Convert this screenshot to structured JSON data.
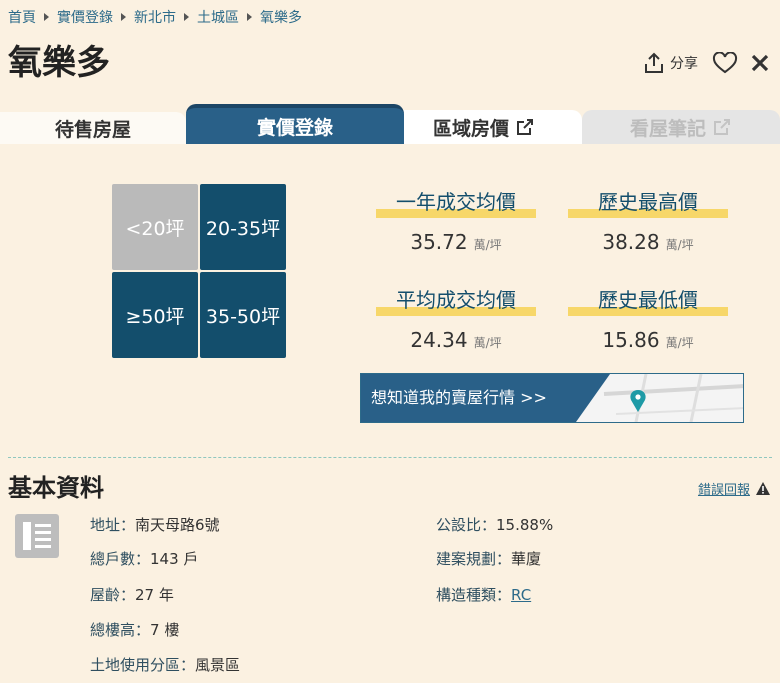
{
  "breadcrumb": [
    "首頁",
    "實價登錄",
    "新北市",
    "土城區",
    "氧樂多"
  ],
  "title": "氧樂多",
  "actions": {
    "share_label": "分享"
  },
  "tabs": [
    {
      "label": "待售房屋"
    },
    {
      "label": "實價登錄"
    },
    {
      "label": "區域房價"
    },
    {
      "label": "看屋筆記"
    }
  ],
  "size_grid": [
    {
      "label": "<20坪"
    },
    {
      "label": "20-35坪"
    },
    {
      "label": "≥50坪"
    },
    {
      "label": "35-50坪"
    }
  ],
  "stats": [
    {
      "label": "一年成交均價",
      "value": "35.72",
      "unit": "萬/坪"
    },
    {
      "label": "歷史最高價",
      "value": "38.28",
      "unit": "萬/坪"
    },
    {
      "label": "平均成交均價",
      "value": "24.34",
      "unit": "萬/坪"
    },
    {
      "label": "歷史最低價",
      "value": "15.86",
      "unit": "萬/坪"
    }
  ],
  "banner": {
    "text": "想知道我的賣屋行情 >>"
  },
  "basic": {
    "title": "基本資料",
    "report_label": "錯誤回報",
    "left": [
      {
        "key": "地址：",
        "value": "南天母路6號"
      },
      {
        "key": "總戶數：",
        "value": "143 戶"
      },
      {
        "key": "屋齡：",
        "value": "27 年"
      },
      {
        "key": "總樓高：",
        "value": "7 樓"
      },
      {
        "key": "土地使用分區：",
        "value": "風景區"
      }
    ],
    "right": [
      {
        "key": "公設比：",
        "value": "15.88%"
      },
      {
        "key": "建案規劃：",
        "value": "華廈"
      },
      {
        "key": "構造種類：",
        "value": "RC"
      }
    ]
  },
  "colors": {
    "background": "#fbf1e1",
    "primary": "#296088",
    "dark_cell": "#134e6c",
    "highlight": "#f7d769"
  }
}
